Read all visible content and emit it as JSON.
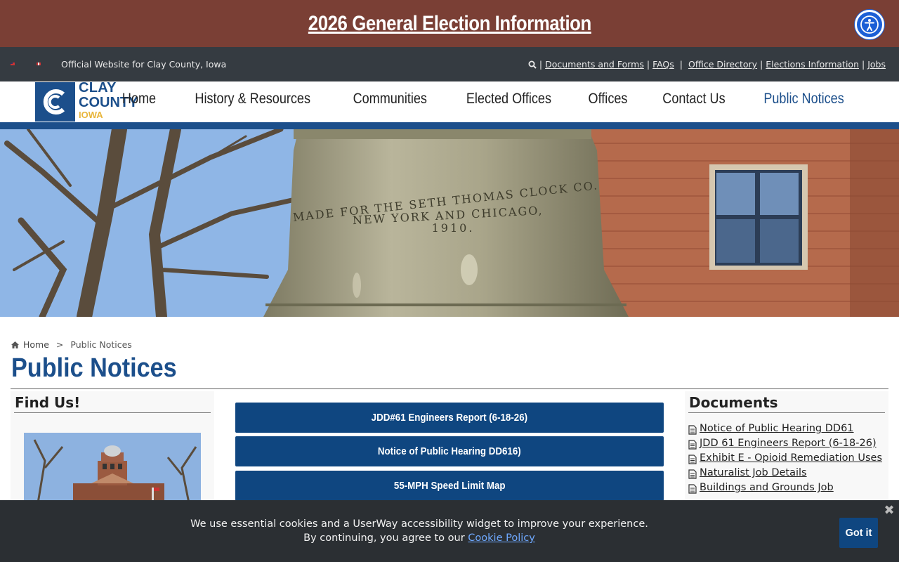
{
  "election_banner": {
    "title": "2026 General Election Information"
  },
  "accessibility": {
    "icon": "accessibility-icon"
  },
  "utility_bar": {
    "tagline": "Official Website for Clay County, Iowa",
    "links": [
      "Documents and Forms",
      "FAQs",
      "Office Directory",
      "Elections Information",
      "Jobs"
    ]
  },
  "logo": {
    "line1": "CLAY",
    "line2": "COUNTY",
    "line3": "IOWA"
  },
  "nav": {
    "items": [
      "Home",
      "History & Resources",
      "Communities",
      "Elected Offices",
      "Offices",
      "Contact Us",
      "Public Notices"
    ],
    "active": "Public Notices"
  },
  "hero": {
    "inscription_1": "MADE FOR THE SETH THOMAS CLOCK CO.",
    "inscription_2": "NEW YORK AND CHICAGO,",
    "inscription_3": "1910."
  },
  "breadcrumb": {
    "home": "Home",
    "separator": ">",
    "current": "Public Notices"
  },
  "page": {
    "title": "Public Notices"
  },
  "left": {
    "heading": "Find Us!"
  },
  "center": {
    "buttons": [
      "JDD#61 Engineers Report (6-18-26)",
      "Notice of Public Hearing DD616)",
      "55-MPH Speed Limit Map"
    ]
  },
  "documents": {
    "heading": "Documents",
    "items": [
      "Notice of Public Hearing DD61",
      "JDD 61 Engineers Report (6-18-26)",
      "Exhibit E - Opioid Remediation Uses",
      "Naturalist Job Details",
      "Buildings and Grounds Job"
    ]
  },
  "cookie": {
    "line1": "We use essential cookies and a UserWay accessibility widget to improve your experience.",
    "line2": "By continuing, you agree to our",
    "link": "Cookie Policy",
    "button": "Got it",
    "close": "✖"
  },
  "colors": {
    "brand": "#1c4f8b",
    "banner": "#7a3f35",
    "utility": "#353b41",
    "button": "#0f4680",
    "accent_yellow": "#e8b53a"
  }
}
